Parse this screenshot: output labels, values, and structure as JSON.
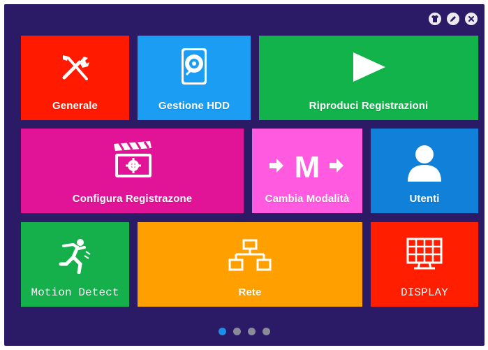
{
  "window": {
    "controls": [
      {
        "name": "skin-icon"
      },
      {
        "name": "edit-icon"
      },
      {
        "name": "close-icon"
      }
    ]
  },
  "tiles": {
    "generale": {
      "label": "Generale",
      "color": "#ff1a00",
      "icon": "tools-icon"
    },
    "gestione_hdd": {
      "label": "Gestione HDD",
      "color": "#1a9df2",
      "icon": "hdd-icon"
    },
    "riproduci": {
      "label": "Riproduci Registrazioni",
      "color": "#12b34a",
      "icon": "play-icon"
    },
    "configura": {
      "label": "Configura Registrazone",
      "color": "#e11396",
      "icon": "clapperboard-icon"
    },
    "cambia": {
      "label": "Cambia Modalità",
      "color": "#ff5ae0",
      "icon": "mode-switch-icon",
      "glyph": "M"
    },
    "utenti": {
      "label": "Utenti",
      "color": "#1180d9",
      "icon": "user-icon"
    },
    "motion": {
      "label": "Motion Detect",
      "color": "#15b04b",
      "icon": "running-man-icon"
    },
    "rete": {
      "label": "Rete",
      "color": "#ffa000",
      "icon": "network-icon"
    },
    "display": {
      "label": "DISPLAY",
      "color": "#ff1e00",
      "icon": "monitor-grid-icon"
    }
  },
  "pagination": {
    "pages": 4,
    "current": 1,
    "active_color": "#1a8fe8",
    "inactive_color": "#8a8a99"
  }
}
